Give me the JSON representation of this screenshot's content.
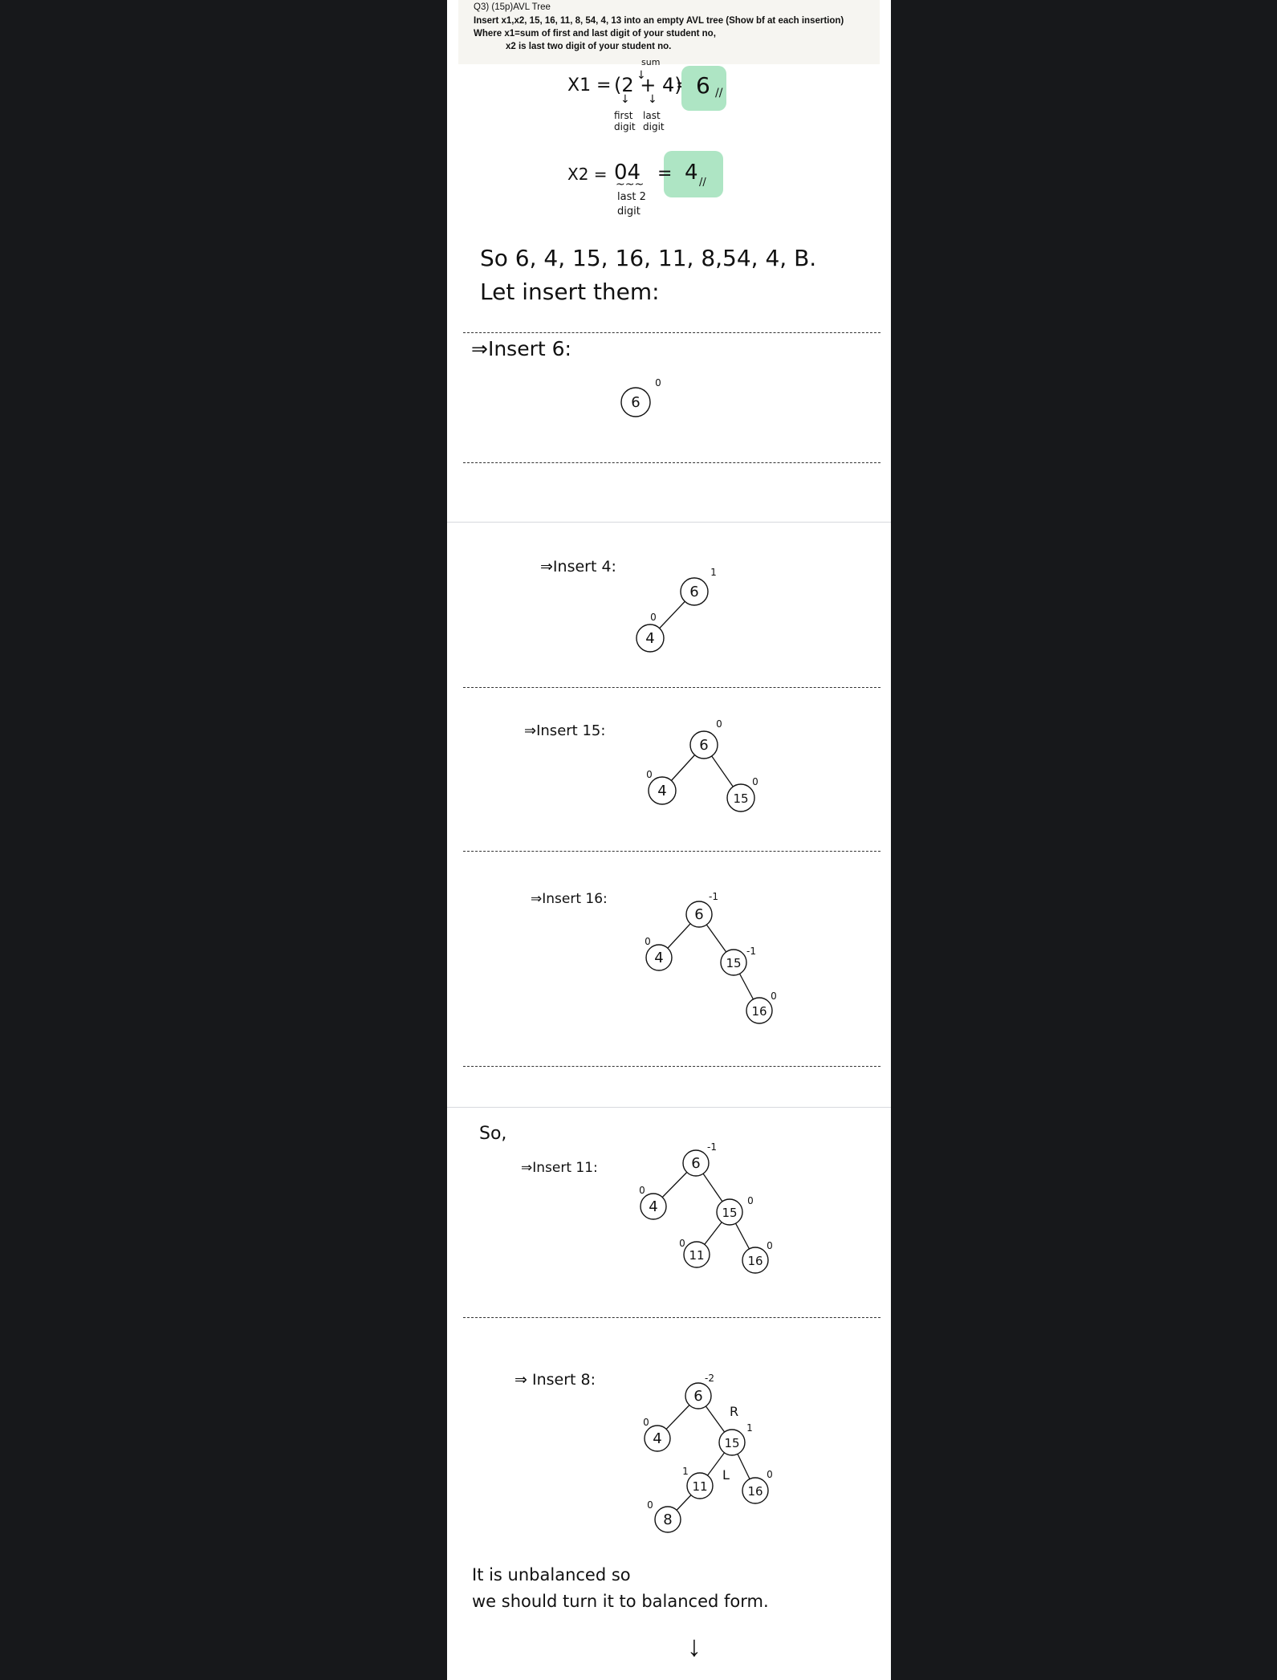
{
  "question": {
    "title": "Q3) (15p)AVL Tree",
    "line1": "Insert x1,x2, 15, 16, 11, 8, 54, 4, 13 into an empty AVL tree (Show bf at each insertion)",
    "line2": "Where x1=sum of first and last digit of your student no,",
    "line3": "x2 is last two digit of your student no."
  },
  "calc": {
    "sum_label": "sum",
    "x1_label": "X1 =",
    "x1_expr": "(2 + 4)",
    "x1_eq": "=",
    "x1_result": "6",
    "first_digit": "first digit",
    "last_digit": "last digit",
    "x2_label": "X2 =",
    "x2_expr": "04",
    "x2_eq": "=",
    "x2_result": "4",
    "last2_digit": "last 2 digit"
  },
  "sequence_text": "So 6, 4, 15, 16, 11, 8,54, 4, B.",
  "insert_intro": "Let insert them:",
  "steps": {
    "insert6": "Insert 6:",
    "insert4": "Insert 4:",
    "insert15": "Insert 15:",
    "insert16": "Insert 16:",
    "so": "So,",
    "insert11": "Insert 11:",
    "insert8": "⇒ Insert 8:"
  },
  "trees": {
    "t6": {
      "nodes": [
        {
          "v": "6",
          "bf": "0"
        }
      ]
    },
    "t4": {
      "nodes": [
        {
          "v": "6",
          "bf": "1"
        },
        {
          "v": "4",
          "bf": "0"
        }
      ]
    },
    "t15": {
      "nodes": [
        {
          "v": "6",
          "bf": "0"
        },
        {
          "v": "4",
          "bf": "0"
        },
        {
          "v": "15",
          "bf": "0"
        }
      ]
    },
    "t16": {
      "nodes": [
        {
          "v": "6",
          "bf": "-1"
        },
        {
          "v": "4",
          "bf": "0"
        },
        {
          "v": "15",
          "bf": "-1"
        },
        {
          "v": "16",
          "bf": "0"
        }
      ]
    },
    "t11": {
      "nodes": [
        {
          "v": "6",
          "bf": "-1"
        },
        {
          "v": "4",
          "bf": "0"
        },
        {
          "v": "15",
          "bf": "0"
        },
        {
          "v": "11",
          "bf": "0"
        },
        {
          "v": "16",
          "bf": "0"
        }
      ]
    },
    "t8": {
      "nodes": [
        {
          "v": "6",
          "bf": "-2"
        },
        {
          "v": "4",
          "bf": "0"
        },
        {
          "v": "15",
          "bf": "1"
        },
        {
          "v": "11",
          "bf": "1"
        },
        {
          "v": "16",
          "bf": "0"
        },
        {
          "v": "8",
          "bf": "0"
        }
      ],
      "marks": {
        "r": "R",
        "l": "L"
      }
    }
  },
  "conclusion": {
    "line1": "It is unbalanced so",
    "line2": "we should turn it to balanced form."
  },
  "icons": {
    "arrow": "down-arrow-icon",
    "implies": "implies-arrow-icon"
  },
  "colors": {
    "highlight": "#aee5c4",
    "background": "#17181b",
    "paper": "#ffffff"
  }
}
